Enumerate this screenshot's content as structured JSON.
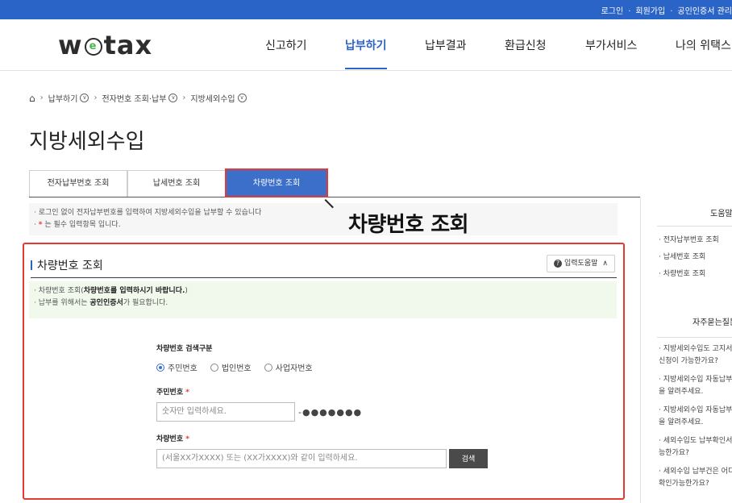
{
  "topbar": {
    "links": [
      "로그인",
      "회원가입",
      "공인인증서 관리"
    ],
    "separator": "·"
  },
  "header": {
    "logo": "wetax",
    "menu": [
      "신고하기",
      "납부하기",
      "납부결과",
      "환급신청",
      "부가서비스",
      "나의 위택스"
    ],
    "active_menu": "납부하기"
  },
  "breadcrumb": {
    "items": [
      "납부하기",
      "전자번호 조회·납부",
      "지방세외수입"
    ]
  },
  "page_title": "지방세외수입",
  "tabs": [
    "전자납부번호 조회",
    "납세번호 조회",
    "차량번호 조회"
  ],
  "active_tab": "차량번호 조회",
  "notice": {
    "line1": "· 로그인 없이 전자납부번호를 입력하여 지방세외수입을 납부할 수 있습니다",
    "line2_req": "*",
    "line2": "는 필수 입력항목 입니다."
  },
  "callout": "차량번호 조회",
  "section": {
    "title": "차량번호 조회",
    "help_button": "입력도움말",
    "info_line1_prefix": "· 차량번호 조회(",
    "info_line1_bold": "차량번호를 입력하시기 바랍니다.",
    "info_line1_suffix": ")",
    "info_line2_prefix": "· 납부를 위해서는 ",
    "info_line2_bold": "공인인증서",
    "info_line2_suffix": "가 필요합니다."
  },
  "form": {
    "search_type_label": "차량번호 검색구분",
    "radio_options": [
      "주민번호",
      "법인번호",
      "사업자번호"
    ],
    "selected_radio": "주민번호",
    "resident_label": "주민번호",
    "resident_placeholder": "숫자만 입력하세요.",
    "resident_masked": "-●●●●●●●",
    "car_label": "차량번호",
    "car_placeholder": "(서울XX가XXXX) 또는 (XX가XXXX)와 같이 입력하세요.",
    "search_button": "검색",
    "required_mark": "*"
  },
  "sidebar": {
    "help_title": "도움말",
    "help_items": [
      "· 전자납부번호 조회",
      "· 납세번호 조회",
      "· 차량번호 조회"
    ],
    "faq_title": "자주묻는질문",
    "faq_items": [
      [
        "· 지방세외수입도 고지서",
        "신청이 가능한가요?"
      ],
      [
        "· 지방세외수입 자동납부",
        "을 알려주세요."
      ],
      [
        "· 지방세외수입 자동납부",
        "을 알려주세요."
      ],
      [
        "· 세외수입도 납부확인서",
        "능한가요?"
      ],
      [
        "· 세외수입 납부건은 어디",
        "확인가능한가요?"
      ]
    ]
  },
  "colors": {
    "brand_blue": "#2b64c7",
    "tab_active": "#3b6fc9",
    "highlight_red": "#e53935",
    "info_bg": "#f1f8ec"
  }
}
